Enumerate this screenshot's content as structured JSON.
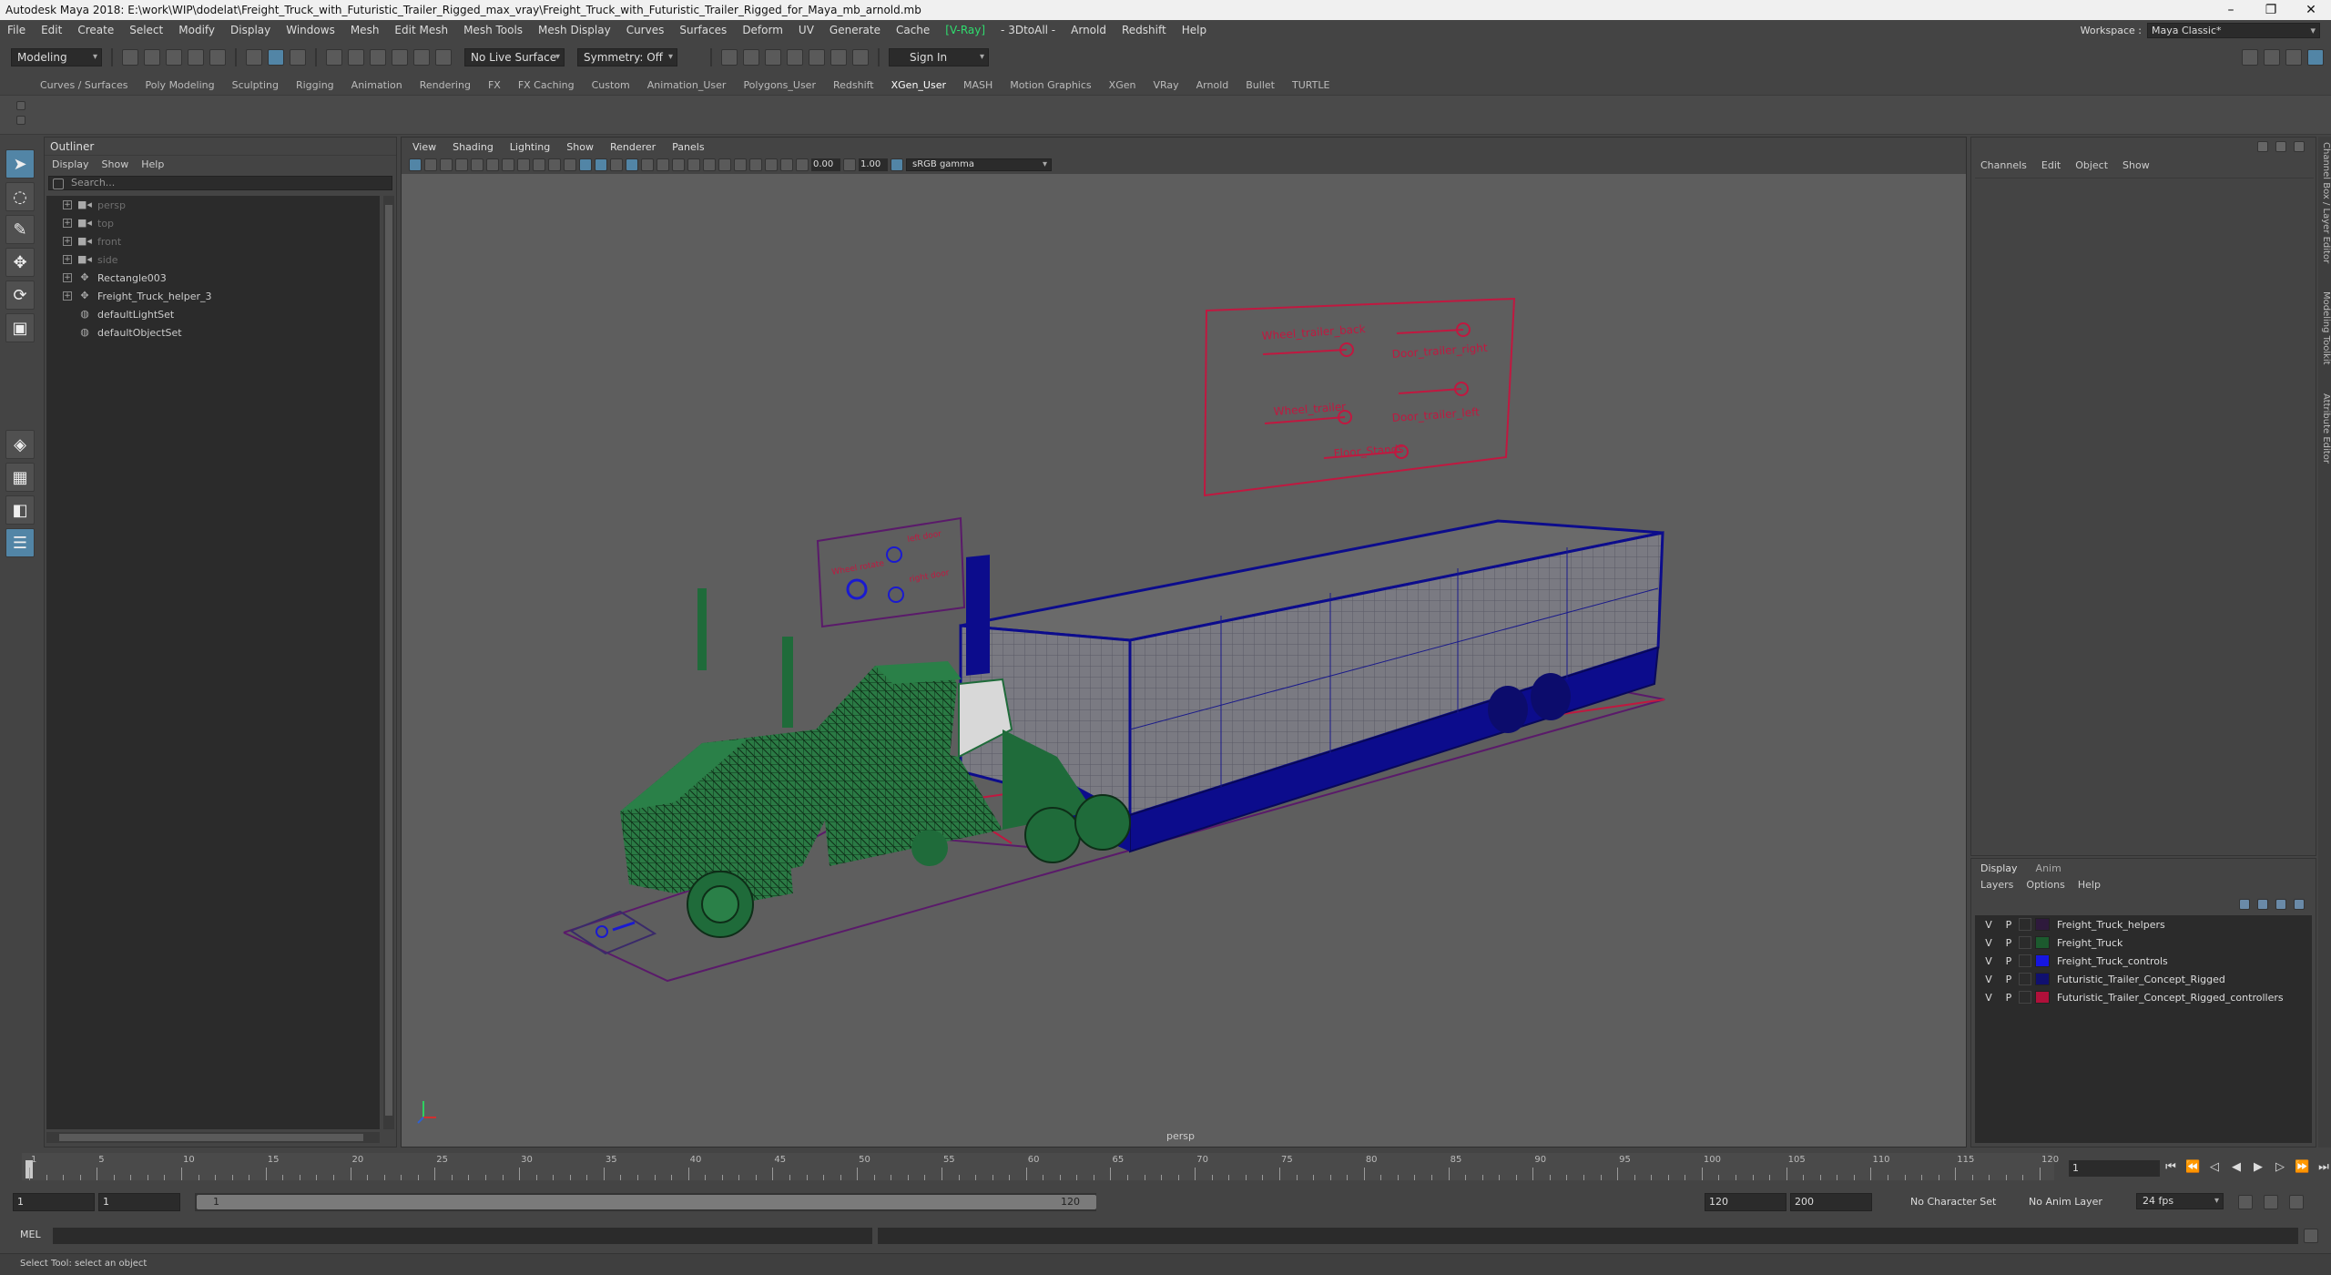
{
  "window": {
    "title": "Autodesk Maya 2018: E:\\work\\WIP\\dodelat\\Freight_Truck_with_Futuristic_Trailer_Rigged_max_vray\\Freight_Truck_with_Futuristic_Trailer_Rigged_for_Maya_mb_arnold.mb",
    "minimize": "–",
    "maximize": "❐",
    "close": "✕"
  },
  "menubar": {
    "items": [
      "File",
      "Edit",
      "Create",
      "Select",
      "Modify",
      "Display",
      "Windows",
      "Mesh",
      "Edit Mesh",
      "Mesh Tools",
      "Mesh Display",
      "Curves",
      "Surfaces",
      "Deform",
      "UV",
      "Generate",
      "Cache",
      "V-Ray",
      "- 3DtoAll -",
      "Arnold",
      "Redshift",
      "Help"
    ],
    "workspace_label": "Workspace :",
    "workspace_value": "Maya Classic*"
  },
  "statusline": {
    "mode": "Modeling",
    "live_surface": "No Live Surface",
    "symmetry": "Symmetry: Off",
    "sign_in": "Sign In"
  },
  "shelf": {
    "tabs": [
      "Curves / Surfaces",
      "Poly Modeling",
      "Sculpting",
      "Rigging",
      "Animation",
      "Rendering",
      "FX",
      "FX Caching",
      "Custom",
      "Animation_User",
      "Polygons_User",
      "Redshift",
      "XGen_User",
      "MASH",
      "Motion Graphics",
      "XGen",
      "VRay",
      "Arnold",
      "Bullet",
      "TURTLE"
    ],
    "active": "XGen_User"
  },
  "outliner": {
    "title": "Outliner",
    "menus": [
      "Display",
      "Show",
      "Help"
    ],
    "search_placeholder": "Search...",
    "items": [
      {
        "label": "persp",
        "icon": "camera-icon",
        "dim": true,
        "expand": "+"
      },
      {
        "label": "top",
        "icon": "camera-icon",
        "dim": true,
        "expand": "+"
      },
      {
        "label": "front",
        "icon": "camera-icon",
        "dim": true,
        "expand": "+"
      },
      {
        "label": "side",
        "icon": "camera-icon",
        "dim": true,
        "expand": "+"
      },
      {
        "label": "Rectangle003",
        "icon": "transform-icon",
        "dim": false,
        "expand": "+"
      },
      {
        "label": "Freight_Truck_helper_3",
        "icon": "transform-icon",
        "dim": false,
        "expand": "+"
      },
      {
        "label": "defaultLightSet",
        "icon": "set-icon",
        "dim": false,
        "expand": ""
      },
      {
        "label": "defaultObjectSet",
        "icon": "set-icon",
        "dim": false,
        "expand": ""
      }
    ]
  },
  "viewport": {
    "menus": [
      "View",
      "Shading",
      "Lighting",
      "Show",
      "Renderer",
      "Panels"
    ],
    "exposure": "0.00",
    "gamma": "1.00",
    "color_space": "sRGB gamma",
    "camera": "persp",
    "controls": {
      "trailer_panel": [
        "Wheel_trailer_back",
        "Door_trailer_right",
        "Wheel_trailer",
        "Door_trailer_left",
        "Floor_Stands"
      ],
      "truck_panel": [
        "left door",
        "Wheel rotate",
        "right door"
      ]
    }
  },
  "channelbox": {
    "menus": [
      "Channels",
      "Edit",
      "Object",
      "Show"
    ],
    "side_tabs": [
      "Channel Box / Layer Editor",
      "Modeling Toolkit",
      "Attribute Editor"
    ]
  },
  "layereditor": {
    "tabs": [
      "Display",
      "Anim"
    ],
    "active_tab": "Display",
    "menus": [
      "Layers",
      "Options",
      "Help"
    ],
    "layers": [
      {
        "v": "V",
        "p": "P",
        "name": "Freight_Truck_helpers",
        "color": "#2e1a3c"
      },
      {
        "v": "V",
        "p": "P",
        "name": "Freight_Truck",
        "color": "#1c5a2e"
      },
      {
        "v": "V",
        "p": "P",
        "name": "Freight_Truck_controls",
        "color": "#1616e0"
      },
      {
        "v": "V",
        "p": "P",
        "name": "Futuristic_Trailer_Concept_Rigged",
        "color": "#101070"
      },
      {
        "v": "V",
        "p": "P",
        "name": "Futuristic_Trailer_Concept_Rigged_controllers",
        "color": "#b0103a"
      }
    ]
  },
  "timeslider": {
    "ticks": [
      "1",
      "5",
      "10",
      "15",
      "20",
      "25",
      "30",
      "35",
      "40",
      "45",
      "50",
      "55",
      "60",
      "65",
      "70",
      "75",
      "80",
      "85",
      "90",
      "95",
      "100",
      "105",
      "110",
      "115",
      "120"
    ],
    "current_frame": "1"
  },
  "rangeslider": {
    "start": "1",
    "playback_start": "1",
    "range_start_label": "1",
    "range_end_label": "120",
    "playback_end": "120",
    "end": "200",
    "character_set": "No Character Set",
    "anim_layer": "No Anim Layer",
    "fps": "24 fps"
  },
  "cmdline": {
    "label": "MEL"
  },
  "helpline": {
    "text": "Select Tool: select an object"
  },
  "colors": {
    "truck_green": "#1f6b3a",
    "trailer_blue": "#0c0c8c",
    "control_red": "#b8143e",
    "accent": "#5285a6"
  }
}
